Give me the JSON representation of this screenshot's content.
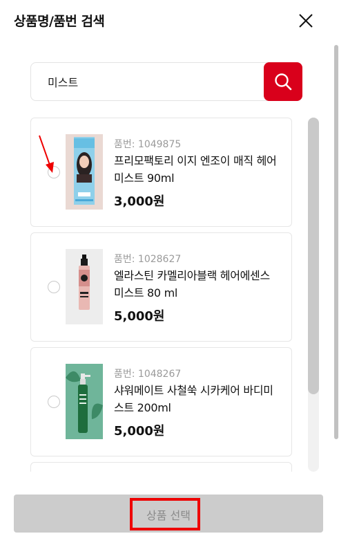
{
  "header": {
    "title": "상품명/품번 검색"
  },
  "search": {
    "value": "미스트"
  },
  "products": [
    {
      "code": "품번: 1049875",
      "name": "프리모팩토리 이지 엔조이 매직 헤어미스트 90ml",
      "price": "3,000원"
    },
    {
      "code": "품번: 1028627",
      "name": "엘라스틴 카멜리아블랙 헤어에센스미스트 80 ml",
      "price": "5,000원"
    },
    {
      "code": "품번: 1048267",
      "name": "샤워메이트 사철쑥 시카케어 바디미스트 200ml",
      "price": "5,000원"
    }
  ],
  "footer": {
    "select_label": "상품 선택"
  },
  "colors": {
    "accent": "#d9001b",
    "annotation": "#ee0000",
    "disabled_button": "#cccccc"
  },
  "icons": [
    "close-icon",
    "search-icon",
    "annotation-arrow-icon"
  ]
}
